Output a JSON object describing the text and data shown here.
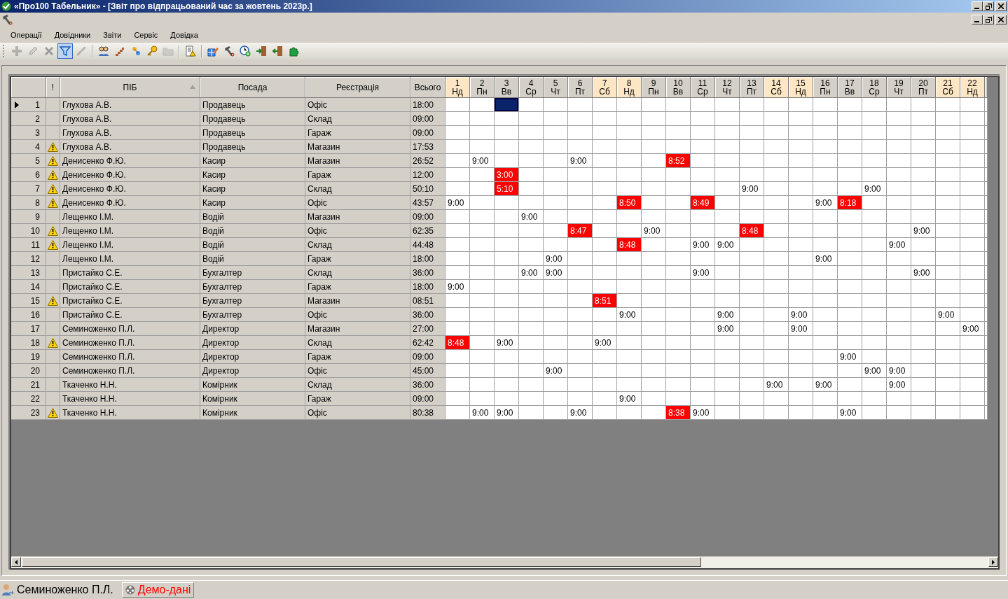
{
  "window": {
    "title": "«Про100 Табельник» - [Звіт про відпрацьований час за жовтень 2023р.]"
  },
  "menu": [
    "Операції",
    "Довідники",
    "Звіти",
    "Сервіс",
    "Довідка"
  ],
  "toolbar": [
    {
      "kind": "plus",
      "disabled": true,
      "pressed": false
    },
    {
      "kind": "pencil",
      "disabled": true,
      "pressed": false
    },
    {
      "kind": "cross",
      "disabled": true,
      "pressed": false
    },
    {
      "kind": "filter",
      "disabled": false,
      "pressed": true
    },
    {
      "kind": "link",
      "disabled": true,
      "pressed": false
    },
    {
      "kind": "separator"
    },
    {
      "kind": "people",
      "disabled": false,
      "pressed": false
    },
    {
      "kind": "stairs",
      "disabled": false,
      "pressed": false
    },
    {
      "kind": "pin",
      "disabled": false,
      "pressed": false
    },
    {
      "kind": "key",
      "disabled": false,
      "pressed": false
    },
    {
      "kind": "folder",
      "disabled": true,
      "pressed": false
    },
    {
      "kind": "separator"
    },
    {
      "kind": "report",
      "disabled": false,
      "pressed": false
    },
    {
      "kind": "separator"
    },
    {
      "kind": "gridpencil",
      "disabled": false,
      "pressed": false
    },
    {
      "kind": "hammer",
      "disabled": false,
      "pressed": false
    },
    {
      "kind": "clock",
      "disabled": false,
      "pressed": false
    },
    {
      "kind": "doorin",
      "disabled": false,
      "pressed": false
    },
    {
      "kind": "doorout",
      "disabled": false,
      "pressed": false
    },
    {
      "kind": "puzzle",
      "disabled": false,
      "pressed": false
    }
  ],
  "table": {
    "columns": [
      {
        "label": "!",
        "sorted": false
      },
      {
        "label": "ПІБ",
        "sorted": true
      },
      {
        "label": "Посада",
        "sorted": false
      },
      {
        "label": "Реєстрація",
        "sorted": false
      },
      {
        "label": "Всього",
        "sorted": false
      }
    ],
    "days": [
      {
        "day": "1",
        "weekday": "Нд",
        "weekend": true
      },
      {
        "day": "2",
        "weekday": "Пн",
        "weekend": false
      },
      {
        "day": "3",
        "weekday": "Вв",
        "weekend": false
      },
      {
        "day": "4",
        "weekday": "Ср",
        "weekend": false
      },
      {
        "day": "5",
        "weekday": "Чт",
        "weekend": false
      },
      {
        "day": "6",
        "weekday": "Пт",
        "weekend": false
      },
      {
        "day": "7",
        "weekday": "Сб",
        "weekend": true
      },
      {
        "day": "8",
        "weekday": "Нд",
        "weekend": true
      },
      {
        "day": "9",
        "weekday": "Пн",
        "weekend": false
      },
      {
        "day": "10",
        "weekday": "Вв",
        "weekend": false
      },
      {
        "day": "11",
        "weekday": "Ср",
        "weekend": false
      },
      {
        "day": "12",
        "weekday": "Чт",
        "weekend": false
      },
      {
        "day": "13",
        "weekday": "Пт",
        "weekend": false
      },
      {
        "day": "14",
        "weekday": "Сб",
        "weekend": true
      },
      {
        "day": "15",
        "weekday": "Нд",
        "weekend": true
      },
      {
        "day": "16",
        "weekday": "Пн",
        "weekend": false
      },
      {
        "day": "17",
        "weekday": "Вв",
        "weekend": false
      },
      {
        "day": "18",
        "weekday": "Ср",
        "weekend": false
      },
      {
        "day": "19",
        "weekday": "Чт",
        "weekend": false
      },
      {
        "day": "20",
        "weekday": "Пт",
        "weekend": false
      },
      {
        "day": "21",
        "weekday": "Сб",
        "weekend": true
      },
      {
        "day": "22",
        "weekday": "Нд",
        "weekend": true
      }
    ],
    "rows": [
      {
        "num": "1",
        "current": true,
        "warning": false,
        "name": "Глухова А.В.",
        "position": "Продавець",
        "location": "Офіс",
        "total": "18:00",
        "cells": [
          null,
          null,
          {
            "alert": false,
            "selected": true
          },
          null,
          null,
          null,
          null,
          null,
          null,
          null,
          null,
          null,
          null,
          null,
          null,
          null,
          null,
          null,
          null,
          null,
          null,
          null
        ]
      },
      {
        "num": "2",
        "current": false,
        "warning": false,
        "name": "Глухова А.В.",
        "position": "Продавець",
        "location": "Склад",
        "total": "09:00",
        "cells": [
          null,
          null,
          null,
          null,
          null,
          null,
          null,
          null,
          null,
          null,
          null,
          null,
          null,
          null,
          null,
          null,
          null,
          null,
          null,
          null,
          null,
          null
        ]
      },
      {
        "num": "3",
        "current": false,
        "warning": false,
        "name": "Глухова А.В.",
        "position": "Продавець",
        "location": "Гараж",
        "total": "09:00",
        "cells": [
          null,
          null,
          null,
          null,
          null,
          null,
          null,
          null,
          null,
          null,
          null,
          null,
          null,
          null,
          null,
          null,
          null,
          null,
          null,
          null,
          null,
          null
        ]
      },
      {
        "num": "4",
        "current": false,
        "warning": true,
        "name": "Глухова А.В.",
        "position": "Продавець",
        "location": "Магазин",
        "total": "17:53",
        "cells": [
          null,
          null,
          null,
          null,
          null,
          null,
          null,
          null,
          null,
          null,
          null,
          null,
          null,
          null,
          null,
          null,
          null,
          null,
          null,
          null,
          null,
          null
        ]
      },
      {
        "num": "5",
        "current": false,
        "warning": true,
        "name": "Денисенко Ф.Ю.",
        "position": "Касир",
        "location": "Магазин",
        "total": "26:52",
        "cells": [
          null,
          {
            "text": "9:00",
            "alert": false,
            "selected": false
          },
          null,
          null,
          null,
          {
            "text": "9:00",
            "alert": false,
            "selected": false
          },
          null,
          null,
          null,
          {
            "text": "8:52",
            "alert": true,
            "selected": false
          },
          null,
          null,
          null,
          null,
          null,
          null,
          null,
          null,
          null,
          null,
          null,
          null
        ]
      },
      {
        "num": "6",
        "current": false,
        "warning": true,
        "name": "Денисенко Ф.Ю.",
        "position": "Касир",
        "location": "Гараж",
        "total": "12:00",
        "cells": [
          null,
          null,
          {
            "text": "3:00",
            "alert": true,
            "selected": false
          },
          null,
          null,
          null,
          null,
          null,
          null,
          null,
          null,
          null,
          null,
          null,
          null,
          null,
          null,
          null,
          null,
          null,
          null,
          null
        ]
      },
      {
        "num": "7",
        "current": false,
        "warning": true,
        "name": "Денисенко Ф.Ю.",
        "position": "Касир",
        "location": "Склад",
        "total": "50:10",
        "cells": [
          null,
          null,
          {
            "text": "5:10",
            "alert": true,
            "selected": false
          },
          null,
          null,
          null,
          null,
          null,
          null,
          null,
          null,
          null,
          {
            "text": "9:00",
            "alert": false,
            "selected": false
          },
          null,
          null,
          null,
          null,
          {
            "text": "9:00",
            "alert": false,
            "selected": false
          },
          null,
          null,
          null,
          null
        ]
      },
      {
        "num": "8",
        "current": false,
        "warning": true,
        "name": "Денисенко Ф.Ю.",
        "position": "Касир",
        "location": "Офіс",
        "total": "43:57",
        "cells": [
          {
            "text": "9:00",
            "alert": false,
            "selected": false
          },
          null,
          null,
          null,
          null,
          null,
          null,
          {
            "text": "8:50",
            "alert": true,
            "selected": false
          },
          null,
          null,
          {
            "text": "8:49",
            "alert": true,
            "selected": false
          },
          null,
          null,
          null,
          null,
          {
            "text": "9:00",
            "alert": false,
            "selected": false
          },
          {
            "text": "8:18",
            "alert": true,
            "selected": false
          },
          null,
          null,
          null,
          null,
          null
        ]
      },
      {
        "num": "9",
        "current": false,
        "warning": false,
        "name": "Лещенко І.М.",
        "position": "Водій",
        "location": "Магазин",
        "total": "09:00",
        "cells": [
          null,
          null,
          null,
          {
            "text": "9:00",
            "alert": false,
            "selected": false
          },
          null,
          null,
          null,
          null,
          null,
          null,
          null,
          null,
          null,
          null,
          null,
          null,
          null,
          null,
          null,
          null,
          null,
          null
        ]
      },
      {
        "num": "10",
        "current": false,
        "warning": true,
        "name": "Лещенко І.М.",
        "position": "Водій",
        "location": "Офіс",
        "total": "62:35",
        "cells": [
          null,
          null,
          null,
          null,
          null,
          {
            "text": "8:47",
            "alert": true,
            "selected": false
          },
          null,
          null,
          {
            "text": "9:00",
            "alert": false,
            "selected": false
          },
          null,
          null,
          null,
          {
            "text": "8:48",
            "alert": true,
            "selected": false
          },
          null,
          null,
          null,
          null,
          null,
          null,
          {
            "text": "9:00",
            "alert": false,
            "selected": false
          },
          null,
          null
        ]
      },
      {
        "num": "11",
        "current": false,
        "warning": true,
        "name": "Лещенко І.М.",
        "position": "Водій",
        "location": "Склад",
        "total": "44:48",
        "cells": [
          null,
          null,
          null,
          null,
          null,
          null,
          null,
          {
            "text": "8:48",
            "alert": true,
            "selected": false
          },
          null,
          null,
          {
            "text": "9:00",
            "alert": false,
            "selected": false
          },
          {
            "text": "9:00",
            "alert": false,
            "selected": false
          },
          null,
          null,
          null,
          null,
          null,
          null,
          {
            "text": "9:00",
            "alert": false,
            "selected": false
          },
          null,
          null,
          null
        ]
      },
      {
        "num": "12",
        "current": false,
        "warning": false,
        "name": "Лещенко І.М.",
        "position": "Водій",
        "location": "Гараж",
        "total": "18:00",
        "cells": [
          null,
          null,
          null,
          null,
          {
            "text": "9:00",
            "alert": false,
            "selected": false
          },
          null,
          null,
          null,
          null,
          null,
          null,
          null,
          null,
          null,
          null,
          {
            "text": "9:00",
            "alert": false,
            "selected": false
          },
          null,
          null,
          null,
          null,
          null,
          null
        ]
      },
      {
        "num": "13",
        "current": false,
        "warning": false,
        "name": "Пристайко С.Е.",
        "position": "Бухгалтер",
        "location": "Склад",
        "total": "36:00",
        "cells": [
          null,
          null,
          null,
          {
            "text": "9:00",
            "alert": false,
            "selected": false
          },
          {
            "text": "9:00",
            "alert": false,
            "selected": false
          },
          null,
          null,
          null,
          null,
          null,
          {
            "text": "9:00",
            "alert": false,
            "selected": false
          },
          null,
          null,
          null,
          null,
          null,
          null,
          null,
          null,
          {
            "text": "9:00",
            "alert": false,
            "selected": false
          },
          null,
          null
        ]
      },
      {
        "num": "14",
        "current": false,
        "warning": false,
        "name": "Пристайко С.Е.",
        "position": "Бухгалтер",
        "location": "Гараж",
        "total": "18:00",
        "cells": [
          {
            "text": "9:00",
            "alert": false,
            "selected": false
          },
          null,
          null,
          null,
          null,
          null,
          null,
          null,
          null,
          null,
          null,
          null,
          null,
          null,
          null,
          null,
          null,
          null,
          null,
          null,
          null,
          null
        ]
      },
      {
        "num": "15",
        "current": false,
        "warning": true,
        "name": "Пристайко С.Е.",
        "position": "Бухгалтер",
        "location": "Магазин",
        "total": "08:51",
        "cells": [
          null,
          null,
          null,
          null,
          null,
          null,
          {
            "text": "8:51",
            "alert": true,
            "selected": false
          },
          null,
          null,
          null,
          null,
          null,
          null,
          null,
          null,
          null,
          null,
          null,
          null,
          null,
          null,
          null
        ]
      },
      {
        "num": "16",
        "current": false,
        "warning": false,
        "name": "Пристайко С.Е.",
        "position": "Бухгалтер",
        "location": "Офіс",
        "total": "36:00",
        "cells": [
          null,
          null,
          null,
          null,
          null,
          null,
          null,
          {
            "text": "9:00",
            "alert": false,
            "selected": false
          },
          null,
          null,
          null,
          {
            "text": "9:00",
            "alert": false,
            "selected": false
          },
          null,
          null,
          {
            "text": "9:00",
            "alert": false,
            "selected": false
          },
          null,
          null,
          null,
          null,
          null,
          {
            "text": "9:00",
            "alert": false,
            "selected": false
          },
          null
        ]
      },
      {
        "num": "17",
        "current": false,
        "warning": false,
        "name": "Семиноженко П.Л.",
        "position": "Директор",
        "location": "Магазин",
        "total": "27:00",
        "cells": [
          null,
          null,
          null,
          null,
          null,
          null,
          null,
          null,
          null,
          null,
          null,
          {
            "text": "9:00",
            "alert": false,
            "selected": false
          },
          null,
          null,
          {
            "text": "9:00",
            "alert": false,
            "selected": false
          },
          null,
          null,
          null,
          null,
          null,
          null,
          {
            "text": "9:00",
            "alert": false,
            "selected": false
          }
        ]
      },
      {
        "num": "18",
        "current": false,
        "warning": true,
        "name": "Семиноженко П.Л.",
        "position": "Директор",
        "location": "Склад",
        "total": "62:42",
        "cells": [
          {
            "text": "8:48",
            "alert": true,
            "selected": false
          },
          null,
          {
            "text": "9:00",
            "alert": false,
            "selected": false
          },
          null,
          null,
          null,
          {
            "text": "9:00",
            "alert": false,
            "selected": false
          },
          null,
          null,
          null,
          null,
          null,
          null,
          null,
          null,
          null,
          null,
          null,
          null,
          null,
          null,
          null
        ]
      },
      {
        "num": "19",
        "current": false,
        "warning": false,
        "name": "Семиноженко П.Л.",
        "position": "Директор",
        "location": "Гараж",
        "total": "09:00",
        "cells": [
          null,
          null,
          null,
          null,
          null,
          null,
          null,
          null,
          null,
          null,
          null,
          null,
          null,
          null,
          null,
          null,
          {
            "text": "9:00",
            "alert": false,
            "selected": false
          },
          null,
          null,
          null,
          null,
          null
        ]
      },
      {
        "num": "20",
        "current": false,
        "warning": false,
        "name": "Семиноженко П.Л.",
        "position": "Директор",
        "location": "Офіс",
        "total": "45:00",
        "cells": [
          null,
          null,
          null,
          null,
          {
            "text": "9:00",
            "alert": false,
            "selected": false
          },
          null,
          null,
          null,
          null,
          null,
          null,
          null,
          null,
          null,
          null,
          null,
          null,
          {
            "text": "9:00",
            "alert": false,
            "selected": false
          },
          {
            "text": "9:00",
            "alert": false,
            "selected": false
          },
          null,
          null,
          null
        ]
      },
      {
        "num": "21",
        "current": false,
        "warning": false,
        "name": "Ткаченко Н.Н.",
        "position": "Комірник",
        "location": "Склад",
        "total": "36:00",
        "cells": [
          null,
          null,
          null,
          null,
          null,
          null,
          null,
          null,
          null,
          null,
          null,
          null,
          null,
          {
            "text": "9:00",
            "alert": false,
            "selected": false
          },
          null,
          {
            "text": "9:00",
            "alert": false,
            "selected": false
          },
          null,
          null,
          {
            "text": "9:00",
            "alert": false,
            "selected": false
          },
          null,
          null,
          null
        ]
      },
      {
        "num": "22",
        "current": false,
        "warning": false,
        "name": "Ткаченко Н.Н.",
        "position": "Комірник",
        "location": "Гараж",
        "total": "09:00",
        "cells": [
          null,
          null,
          null,
          null,
          null,
          null,
          null,
          {
            "text": "9:00",
            "alert": false,
            "selected": false
          },
          null,
          null,
          null,
          null,
          null,
          null,
          null,
          null,
          null,
          null,
          null,
          null,
          null,
          null
        ]
      },
      {
        "num": "23",
        "current": false,
        "warning": true,
        "name": "Ткаченко Н.Н.",
        "position": "Комірник",
        "location": "Офіс",
        "total": "80:38",
        "cells": [
          null,
          {
            "text": "9:00",
            "alert": false,
            "selected": false
          },
          {
            "text": "9:00",
            "alert": false,
            "selected": false
          },
          null,
          null,
          {
            "text": "9:00",
            "alert": false,
            "selected": false
          },
          null,
          null,
          null,
          {
            "text": "8:38",
            "alert": true,
            "selected": false
          },
          {
            "text": "9:00",
            "alert": false,
            "selected": false
          },
          null,
          null,
          null,
          null,
          null,
          {
            "text": "9:00",
            "alert": false,
            "selected": false
          },
          null,
          null,
          null,
          null,
          null
        ]
      }
    ]
  },
  "status_bar": {
    "user": "Семиноженко П.Л.",
    "mode": "Демо-дані"
  }
}
